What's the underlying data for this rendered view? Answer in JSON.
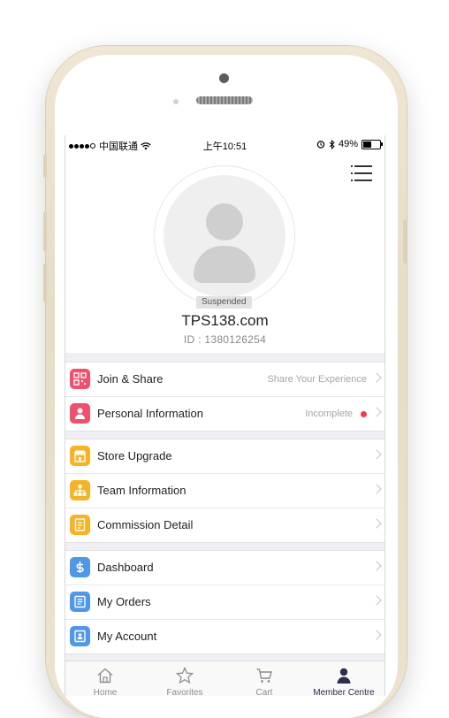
{
  "status_bar": {
    "carrier": "中国联通",
    "time": "上午10:51",
    "battery": "49%",
    "battery_level": 0.49
  },
  "profile": {
    "status_badge": "Suspended",
    "site_name": "TPS138.com",
    "member_id": "ID : 1380126254"
  },
  "menu_groups": [
    {
      "items": [
        {
          "label": "Join & Share",
          "hint": "Share Your Experience",
          "icon": "qr-share-icon",
          "color": "#f0506e"
        },
        {
          "label": "Personal Information",
          "hint": "Incomplete",
          "icon": "person-icon",
          "color": "#f0506e"
        }
      ]
    },
    {
      "items": [
        {
          "label": "Store Upgrade",
          "hint": "",
          "icon": "store-icon",
          "color": "#f5b325"
        },
        {
          "label": "Team Information",
          "hint": "",
          "icon": "team-tree-icon",
          "color": "#f5b325"
        },
        {
          "label": "Commission Detail",
          "hint": "",
          "icon": "document-icon",
          "color": "#f5b325"
        }
      ]
    },
    {
      "items": [
        {
          "label": "Dashboard",
          "hint": "",
          "icon": "dollar-icon",
          "color": "#4f97e8"
        },
        {
          "label": "My Orders",
          "hint": "",
          "icon": "orders-list-icon",
          "color": "#4f97e8"
        },
        {
          "label": "My Account",
          "hint": "",
          "icon": "account-icon",
          "color": "#4f97e8"
        }
      ]
    }
  ],
  "tab_bar": [
    {
      "label": "Home",
      "icon": "home-icon"
    },
    {
      "label": "Favorites",
      "icon": "star-icon"
    },
    {
      "label": "Cart",
      "icon": "cart-icon"
    },
    {
      "label": "Member Centre",
      "icon": "member-icon",
      "active": true
    }
  ],
  "colors": {
    "red_accent": "#f0506e",
    "yellow_accent": "#f5b325",
    "blue_accent": "#4f97e8",
    "active_tab": "#2b2f47",
    "incomplete_dot": "#f23b4b"
  }
}
